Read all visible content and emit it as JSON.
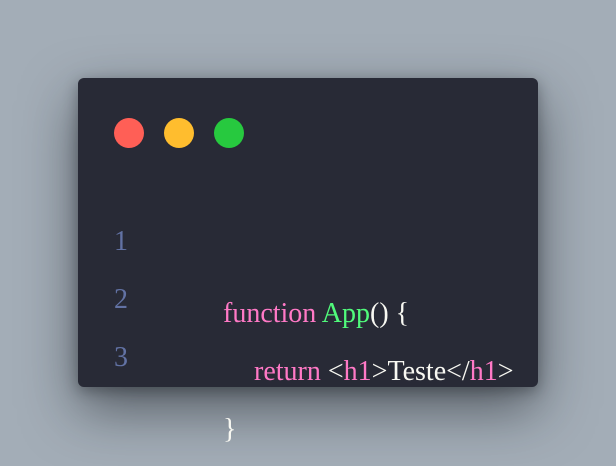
{
  "colors": {
    "background": "#a3adb7",
    "window": "#282a36",
    "dot_red": "#ff5f56",
    "dot_yellow": "#ffbd2e",
    "dot_green": "#27c93f",
    "line_number": "#6272a4",
    "keyword": "#ff79c6",
    "function_name": "#50fa7b",
    "plain": "#f8f8f2"
  },
  "window_controls": [
    "red-dot",
    "yellow-dot",
    "green-dot"
  ],
  "code": {
    "lines": [
      {
        "number": "1",
        "tokens": [
          {
            "text": "function",
            "kind": "keyword"
          },
          {
            "text": " ",
            "kind": "plain"
          },
          {
            "text": "App",
            "kind": "function_name"
          },
          {
            "text": "() {",
            "kind": "plain"
          }
        ]
      },
      {
        "number": "2",
        "tokens": [
          {
            "text": "return",
            "kind": "keyword"
          },
          {
            "text": " <",
            "kind": "plain"
          },
          {
            "text": "h1",
            "kind": "keyword"
          },
          {
            "text": ">Teste</",
            "kind": "plain"
          },
          {
            "text": "h1",
            "kind": "keyword"
          },
          {
            "text": ">",
            "kind": "plain"
          }
        ]
      },
      {
        "number": "3",
        "tokens": [
          {
            "text": "}",
            "kind": "plain"
          }
        ]
      }
    ]
  }
}
